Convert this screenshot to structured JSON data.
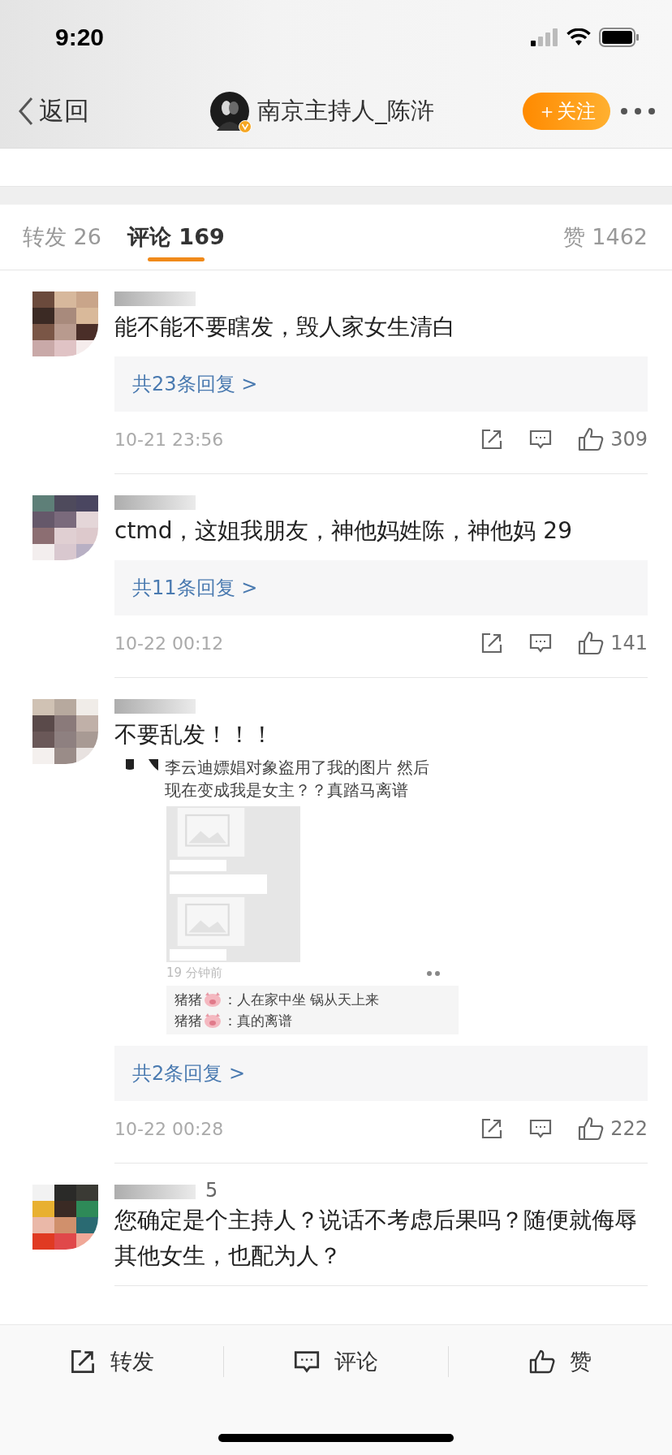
{
  "status_bar": {
    "time": "9:20"
  },
  "nav": {
    "back_label": "返回",
    "title": "南京主持人_陈浒",
    "verified": true,
    "follow_button": "＋关注"
  },
  "tabs": [
    {
      "label": "转发 26",
      "selected": false
    },
    {
      "label": "评论 169",
      "selected": true
    },
    {
      "label": "赞 1462",
      "selected": false
    }
  ],
  "comments": [
    {
      "text": "能不能不要瞎发，毁人家女生清白",
      "replies": "共23条回复 >",
      "time": "10-21 23:56",
      "likes": "309"
    },
    {
      "text": "ctmd，这姐我朋友，神他妈姓陈，神他妈 29",
      "replies": "共11条回复 >",
      "time": "10-22 00:12",
      "likes": "141"
    },
    {
      "text": "不要乱发！！！",
      "embedded_screenshot": {
        "text": "李云迪嫖娼对象盗用了我的图片 然后现在变成我是女主？？真踏马离谱",
        "time": "19 分钟前",
        "replies": [
          {
            "name": "猪猪",
            "text": "：人在家中坐 锅从天上来"
          },
          {
            "name": "猪猪",
            "text": "：真的离谱"
          }
        ]
      },
      "replies": "共2条回复 >",
      "time": "10-22 00:28",
      "likes": "222"
    },
    {
      "username_fragment": "5",
      "text": "您确定是个主持人？说话不考虑后果吗？随便就侮辱其他女生，也配为人？"
    }
  ],
  "bottom_actions": [
    {
      "kind": "share",
      "label": "转发"
    },
    {
      "kind": "comment",
      "label": "评论"
    },
    {
      "kind": "like",
      "label": "赞"
    }
  ]
}
